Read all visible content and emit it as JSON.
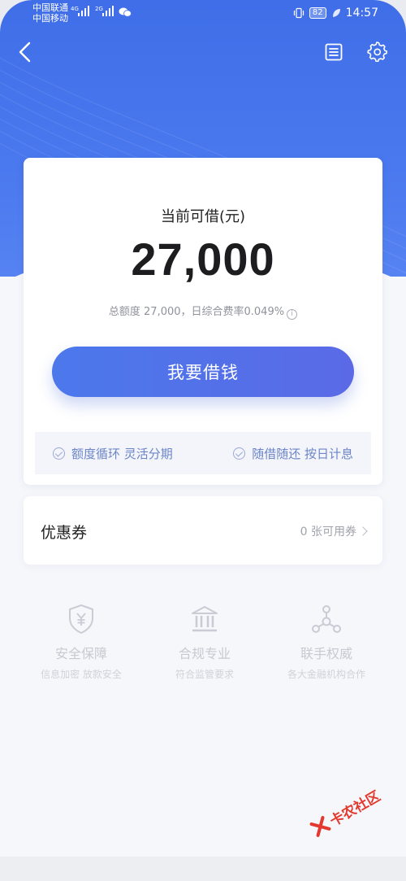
{
  "status_bar": {
    "carrier1": "中国联通",
    "carrier1_net": "4G",
    "carrier2": "中国移动",
    "carrier2_net": "2G",
    "battery": "82",
    "time": "14:57"
  },
  "nav": {
    "back_icon": "chevron-left-icon",
    "record_icon": "document-list-icon",
    "settings_icon": "gear-icon"
  },
  "loan": {
    "label": "当前可借(元)",
    "amount": "27,000",
    "summary": "总额度 27,000，日综合费率0.049%",
    "info_glyph": "i",
    "button_label": "我要借钱"
  },
  "features": [
    {
      "label": "额度循环 灵活分期"
    },
    {
      "label": "随借随还 按日计息"
    }
  ],
  "coupon": {
    "title": "优惠券",
    "available": "0 张可用券"
  },
  "badges": [
    {
      "icon": "shield-yen-icon",
      "title": "安全保障",
      "subtitle": "信息加密 放款安全"
    },
    {
      "icon": "bank-building-icon",
      "title": "合规专业",
      "subtitle": "符合监管要求"
    },
    {
      "icon": "network-nodes-icon",
      "title": "联手权威",
      "subtitle": "各大金融机构合作"
    }
  ],
  "watermark": {
    "text": "卡农社区"
  },
  "colors": {
    "primary": "#4a78ee",
    "button": "#5a6ae6",
    "feature_text": "#6c85c8",
    "watermark": "#e23a2e"
  }
}
